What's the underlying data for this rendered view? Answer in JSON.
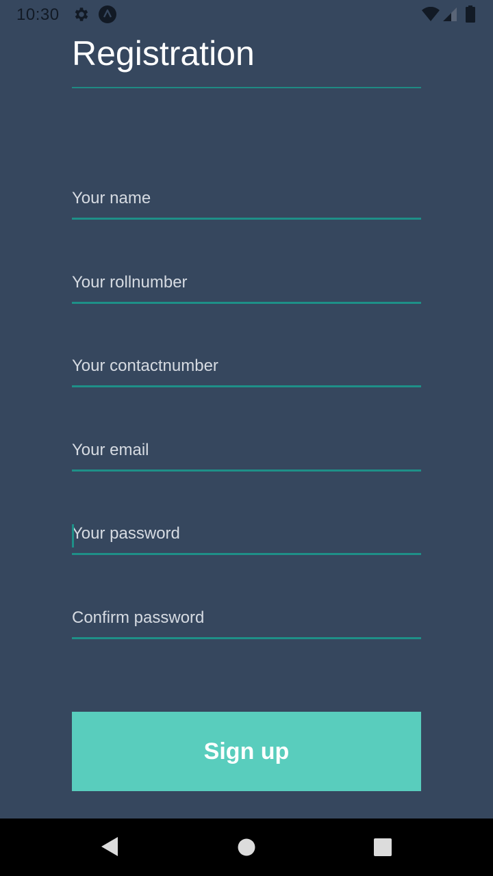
{
  "status_bar": {
    "time": "10:30",
    "icons": [
      "gear-icon",
      "a-badge-icon",
      "wifi-icon",
      "signal-icon",
      "battery-icon"
    ]
  },
  "title": "Registration",
  "fields": [
    {
      "name": "name",
      "placeholder": "Your name",
      "value": ""
    },
    {
      "name": "rollnumber",
      "placeholder": "Your rollnumber",
      "value": ""
    },
    {
      "name": "contactnumber",
      "placeholder": "Your contactnumber",
      "value": ""
    },
    {
      "name": "email",
      "placeholder": "Your email",
      "value": ""
    },
    {
      "name": "password",
      "placeholder": "Your password",
      "value": ""
    },
    {
      "name": "confirm-password",
      "placeholder": "Confirm password",
      "value": ""
    }
  ],
  "signup_button": {
    "label": "Sign up"
  },
  "nav_bar": {
    "icons": [
      "back-icon",
      "home-icon",
      "recents-icon"
    ]
  },
  "colors": {
    "background": "#36475e",
    "accent": "#1e9088",
    "button": "#59cdbd",
    "nav_bar": "#000000"
  }
}
